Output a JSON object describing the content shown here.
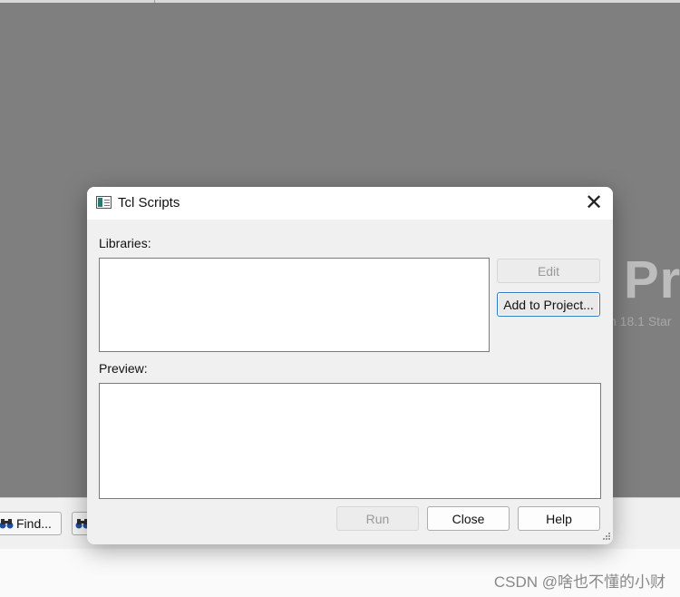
{
  "background": {
    "splash_text": "Pr",
    "splash_subtext": "n 18.1 Star",
    "find_button_label": "Find..."
  },
  "watermark": "CSDN @啥也不懂的小财",
  "dialog": {
    "title": "Tcl Scripts",
    "close_glyph": "✕",
    "libraries_label": "Libraries:",
    "preview_label": "Preview:",
    "buttons": {
      "edit": "Edit",
      "add_to_project": "Add to Project...",
      "run": "Run",
      "close": "Close",
      "help": "Help"
    }
  },
  "colors": {
    "backdrop": "#7f7f7f",
    "dialog_bg": "#f0f0f0",
    "focus_border": "#2f7ac4",
    "icon_accent": "#2b7a6f"
  },
  "icons": [
    "window-icon",
    "close-icon",
    "binoculars-icon",
    "resize-grip-icon"
  ]
}
